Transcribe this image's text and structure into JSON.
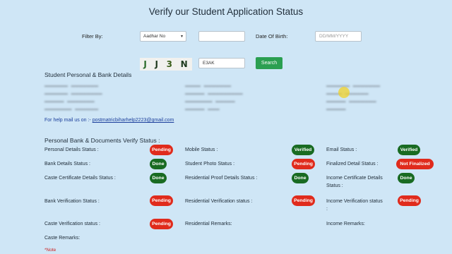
{
  "page": {
    "title": "Verify our Student Application Status"
  },
  "filter": {
    "label": "Filter By:",
    "select_value": "Aadhar No",
    "dob_label": "Date Of Birth:",
    "dob_placeholder": "DD/MM/YYYY"
  },
  "captcha": {
    "chars": [
      "J",
      "J",
      "3",
      "N"
    ],
    "input_value": "E3AK",
    "search_label": "Search"
  },
  "personal": {
    "heading": "Student Personal & Bank Details"
  },
  "help": {
    "prefix": "For help mail us on :-",
    "email": "postmatricbiharhelp2223@gmail.com"
  },
  "verify": {
    "heading": "Personal Bank & Documents Verify Status :",
    "items": [
      {
        "label": "Personal Details Status :",
        "status": "Pending",
        "kind": "pending"
      },
      {
        "label": "Mobile Status :",
        "status": "Verified",
        "kind": "verified"
      },
      {
        "label": "Email Status :",
        "status": "Verified",
        "kind": "verified"
      },
      {
        "label": "Bank Details Status :",
        "status": "Done",
        "kind": "done"
      },
      {
        "label": "Student Photo Status :",
        "status": "Pending",
        "kind": "pending"
      },
      {
        "label": "Finalized Detail Status :",
        "status": "Not Finalized",
        "kind": "notfin"
      },
      {
        "label": "Caste Certificate Details Status :",
        "status": "Done",
        "kind": "done"
      },
      {
        "label": "Residential Proof Details Status :",
        "status": "Done",
        "kind": "done"
      },
      {
        "label": "Income Certificate Details Status :",
        "status": "Done",
        "kind": "done"
      },
      {
        "label": "Bank Verification Status :",
        "status": "Pending",
        "kind": "pending"
      },
      {
        "label": "Residential Verification status :",
        "status": "Pending",
        "kind": "pending"
      },
      {
        "label": "Income Verification status :",
        "status": "Pending",
        "kind": "pending"
      },
      {
        "label": "Caste Verification status :",
        "status": "Pending",
        "kind": "pending"
      }
    ],
    "residential_remarks": "Residential Remarks:",
    "income_remarks": "Income Remarks:",
    "caste_remarks": "Caste Remarks:"
  },
  "note": "*Note",
  "colors": {
    "background": "#cfe6f6",
    "pending": "#e02b1c",
    "done": "#196b22",
    "search": "#2b9f51"
  }
}
